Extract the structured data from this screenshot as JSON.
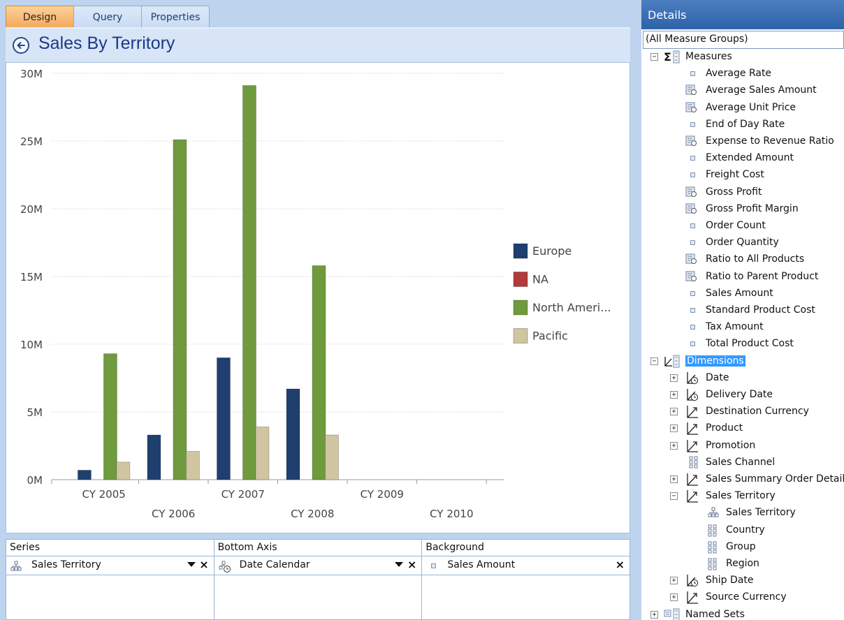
{
  "tabs": [
    {
      "label": "Design",
      "active": true
    },
    {
      "label": "Query",
      "active": false
    },
    {
      "label": "Properties",
      "active": false
    }
  ],
  "page_title": "Sales By Territory",
  "chart_data": {
    "type": "bar",
    "categories": [
      "CY 2005",
      "CY 2006",
      "CY 2007",
      "CY 2008",
      "CY 2009",
      "CY 2010"
    ],
    "series": [
      {
        "name": "Europe",
        "color": "#1f3f6e",
        "values": [
          0.7,
          3.3,
          9.0,
          6.7,
          0,
          0
        ]
      },
      {
        "name": "NA",
        "color": "#b23a38",
        "values": [
          0,
          0,
          0,
          0,
          0,
          0
        ]
      },
      {
        "name": "North Ameri...",
        "color": "#6f9a3e",
        "values": [
          9.3,
          25.1,
          29.1,
          15.8,
          0,
          0
        ]
      },
      {
        "name": "Pacific",
        "color": "#cfc5a0",
        "values": [
          1.3,
          2.1,
          3.9,
          3.3,
          0,
          0
        ]
      }
    ],
    "ylim": [
      0,
      30
    ],
    "y_ticks": [
      "0M",
      "5M",
      "10M",
      "15M",
      "20M",
      "25M",
      "30M"
    ],
    "grid": true,
    "legend_position": "right"
  },
  "drop_zones": [
    {
      "title": "Series",
      "item": "Sales Territory",
      "icon": "hierarchy-icon",
      "dropdown": true
    },
    {
      "title": "Bottom Axis",
      "item": "Date Calendar",
      "icon": "date-hierarchy-icon",
      "dropdown": true
    },
    {
      "title": "Background",
      "item": "Sales Amount",
      "icon": "measure-icon",
      "dropdown": false
    }
  ],
  "details": {
    "header": "Details",
    "measure_group": "(All Measure Groups)",
    "measures_label": "Measures",
    "measures": [
      {
        "label": "Average Rate",
        "icon": "measure-icon"
      },
      {
        "label": "Average Sales Amount",
        "icon": "calculated-measure-icon"
      },
      {
        "label": "Average Unit Price",
        "icon": "calculated-measure-icon"
      },
      {
        "label": "End of Day Rate",
        "icon": "measure-icon"
      },
      {
        "label": "Expense to Revenue Ratio",
        "icon": "calculated-measure-icon"
      },
      {
        "label": "Extended Amount",
        "icon": "measure-icon"
      },
      {
        "label": "Freight Cost",
        "icon": "measure-icon"
      },
      {
        "label": "Gross Profit",
        "icon": "calculated-measure-icon"
      },
      {
        "label": "Gross Profit Margin",
        "icon": "calculated-measure-icon"
      },
      {
        "label": "Order Count",
        "icon": "measure-icon"
      },
      {
        "label": "Order Quantity",
        "icon": "measure-icon"
      },
      {
        "label": "Ratio to All Products",
        "icon": "calculated-measure-icon"
      },
      {
        "label": "Ratio to Parent Product",
        "icon": "calculated-measure-icon"
      },
      {
        "label": "Sales Amount",
        "icon": "measure-icon"
      },
      {
        "label": "Standard Product Cost",
        "icon": "measure-icon"
      },
      {
        "label": "Tax Amount",
        "icon": "measure-icon"
      },
      {
        "label": "Total Product Cost",
        "icon": "measure-icon"
      }
    ],
    "dimensions_label": "Dimensions",
    "dimensions": [
      {
        "label": "Date",
        "icon": "time-dimension-icon",
        "expandable": true
      },
      {
        "label": "Delivery Date",
        "icon": "time-dimension-icon",
        "expandable": true
      },
      {
        "label": "Destination Currency",
        "icon": "dimension-icon",
        "expandable": true
      },
      {
        "label": "Product",
        "icon": "dimension-icon",
        "expandable": true
      },
      {
        "label": "Promotion",
        "icon": "dimension-icon",
        "expandable": true
      },
      {
        "label": "Sales Channel",
        "icon": "attribute-icon",
        "expandable": false
      },
      {
        "label": "Sales Summary Order Details",
        "icon": "dimension-icon",
        "expandable": true
      },
      {
        "label": "Sales Territory",
        "icon": "dimension-icon",
        "expandable": true,
        "expanded": true
      },
      {
        "label": "Ship Date",
        "icon": "time-dimension-icon",
        "expandable": true
      },
      {
        "label": "Source Currency",
        "icon": "dimension-icon",
        "expandable": true
      }
    ],
    "territory_children": [
      {
        "label": "Sales Territory",
        "icon": "hierarchy-icon"
      },
      {
        "label": "Country",
        "icon": "attribute-icon"
      },
      {
        "label": "Group",
        "icon": "attribute-icon"
      },
      {
        "label": "Region",
        "icon": "attribute-icon"
      }
    ],
    "named_sets_label": "Named Sets"
  }
}
